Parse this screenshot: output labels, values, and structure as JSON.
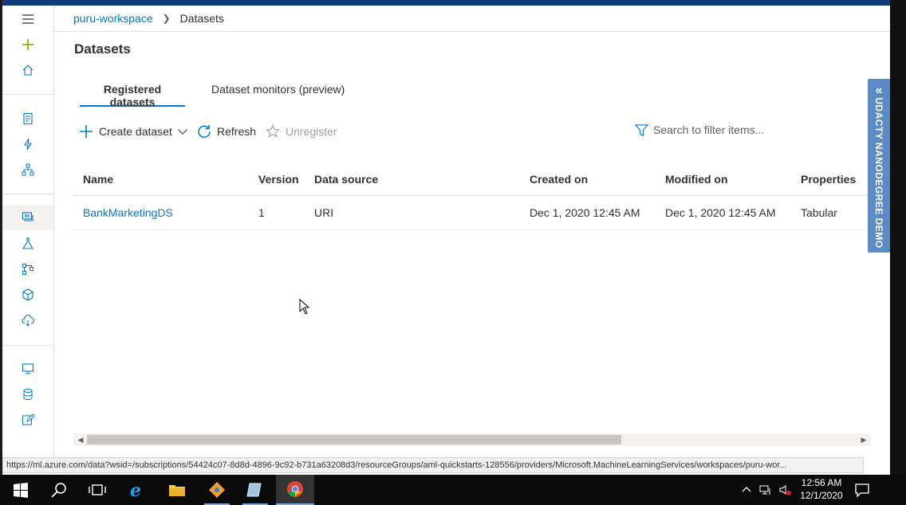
{
  "breadcrumb": {
    "workspace": "puru-workspace",
    "current": "Datasets"
  },
  "page": {
    "title": "Datasets"
  },
  "tabs": [
    {
      "label": "Registered datasets",
      "active": true
    },
    {
      "label": "Dataset monitors (preview)",
      "active": false
    }
  ],
  "commands": {
    "create": "Create dataset",
    "refresh": "Refresh",
    "unregister": "Unregister",
    "search_placeholder": "Search to filter items..."
  },
  "table": {
    "headers": [
      "Name",
      "Version",
      "Data source",
      "Created on",
      "Modified on",
      "Properties"
    ],
    "rows": [
      [
        "BankMarketingDS",
        "1",
        "URI",
        "Dec 1, 2020 12:45 AM",
        "Dec 1, 2020 12:45 AM",
        "Tabular"
      ]
    ]
  },
  "banner": {
    "text": "UDACTY NANODEGREE DEMO"
  },
  "status_url": "https://ml.azure.com/data?wsid=/subscriptions/54424c07-8d8d-4896-9c92-b731a63208d3/resourceGroups/aml-quickstarts-128556/providers/Microsoft.MachineLearningServices/workspaces/puru-wor...",
  "taskbar": {
    "time": "12:56 AM",
    "date": "12/1/2020"
  },
  "colors": {
    "accent": "#0078d4",
    "banner": "#5b8bc4",
    "topbar": "#0f3d7a",
    "add_icon": "#7fba00"
  },
  "rail_icons": [
    "menu-icon",
    "add-icon",
    "home-icon",
    "notebook-icon",
    "automl-icon",
    "designer-icon",
    "datasets-icon",
    "experiments-icon",
    "pipelines-icon",
    "models-icon",
    "endpoints-icon",
    "compute-icon",
    "datastores-icon",
    "labeling-icon"
  ]
}
